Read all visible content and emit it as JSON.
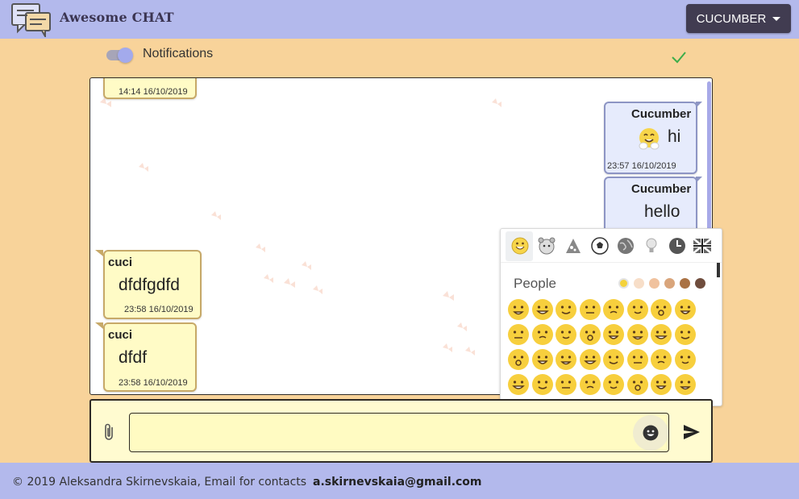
{
  "header": {
    "brand": "Awesome CHAT",
    "user_button": "CUCUMBER"
  },
  "notifications": {
    "label": "Notifications",
    "enabled": true
  },
  "messages": [
    {
      "side": "in",
      "author": "",
      "text": "",
      "time": "14:14 16/10/2019"
    },
    {
      "side": "out",
      "author": "Cucumber",
      "emoji": "smiling-face-with-hugging-hands",
      "text": "hi",
      "time": "23:57 16/10/2019"
    },
    {
      "side": "out",
      "author": "Cucumber",
      "text": "hello",
      "time": ""
    },
    {
      "side": "in",
      "author": "cuci",
      "text": "dfdfgdfd",
      "time": "23:58 16/10/2019"
    },
    {
      "side": "in",
      "author": "cuci",
      "text": "dfdf",
      "time": "23:58 16/10/2019"
    }
  ],
  "emoji_picker": {
    "categories": [
      "smileys-icon",
      "animals-icon",
      "food-icon",
      "activity-icon",
      "travel-icon",
      "objects-icon",
      "symbols-icon",
      "flags-icon"
    ],
    "selected_category": "smileys-icon",
    "section_label": "People",
    "skin_tones": [
      "#f4d23b",
      "#f7dec8",
      "#f0c29e",
      "#d9a57b",
      "#aa7244",
      "#6f4d3d"
    ]
  },
  "composer": {
    "placeholder": ""
  },
  "footer": {
    "copyright": "© 2019 Aleksandra Skirnevskaia, Email for contacts",
    "email": "a.skirnevskaia@gmail.com"
  },
  "colors": {
    "header_bg": "#b3b9ec",
    "page_bg": "#f8d39a",
    "incoming_bubble": "#fffbc6",
    "outgoing_bubble": "#e6ebfc",
    "user_button": "#413c51"
  }
}
